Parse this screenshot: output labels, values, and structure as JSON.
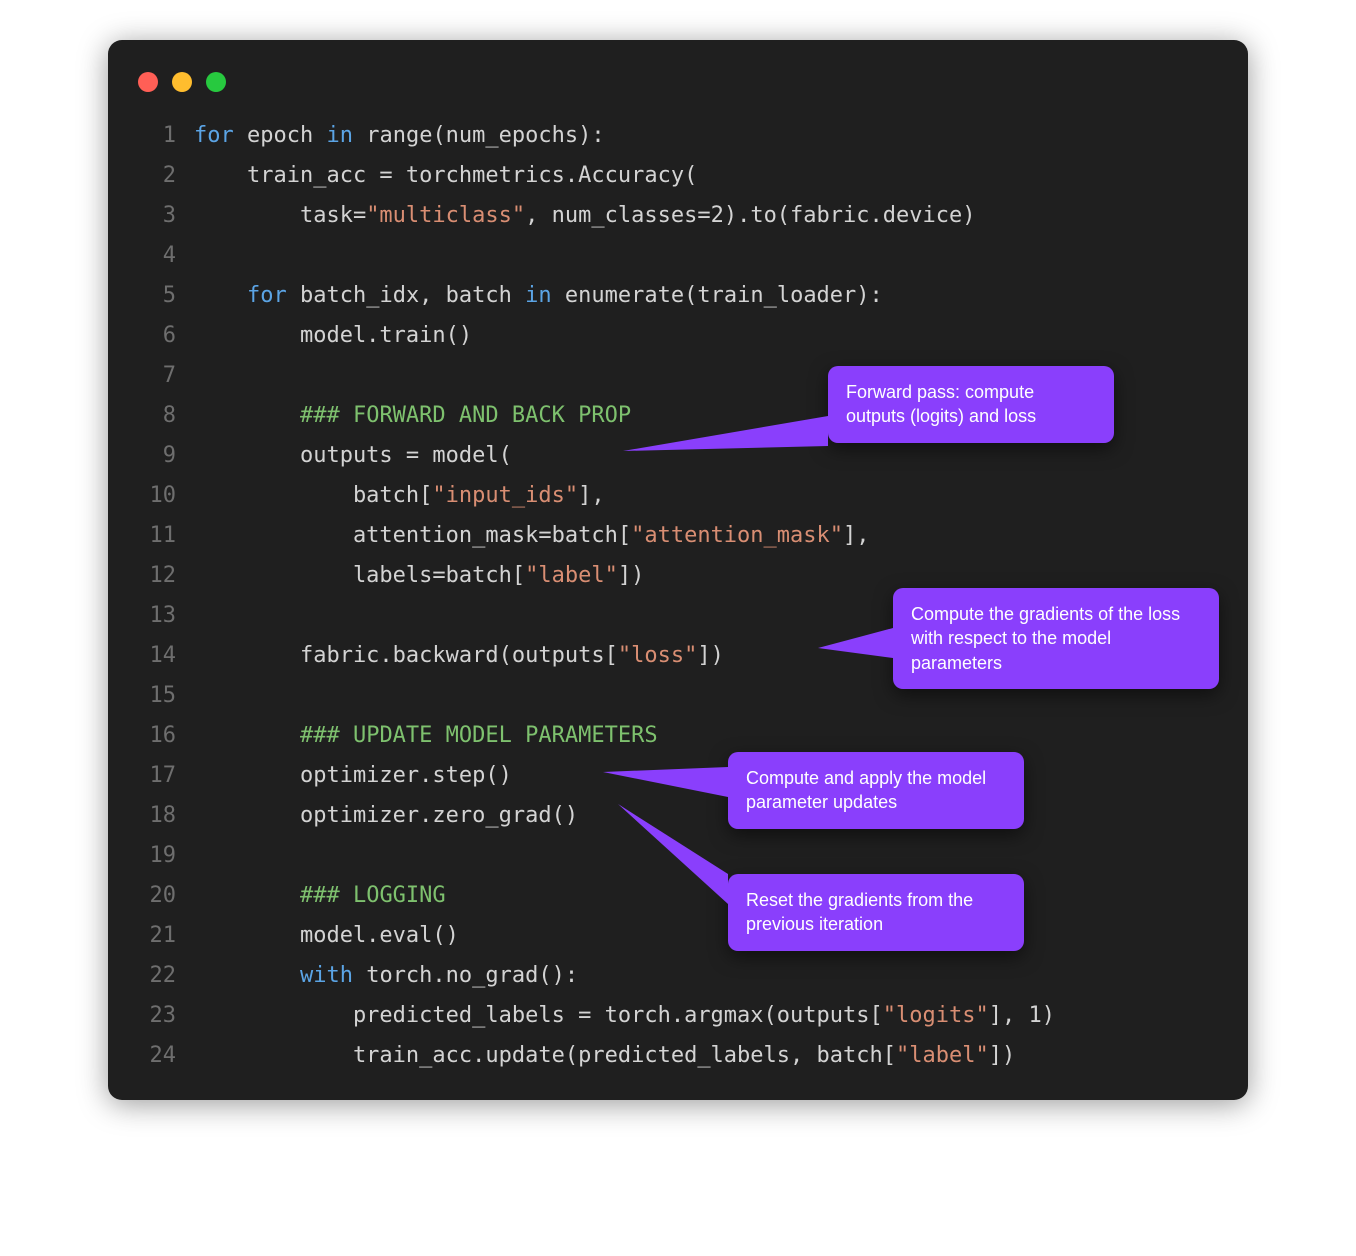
{
  "window": {
    "dots": [
      "red",
      "yellow",
      "green"
    ]
  },
  "code_lines": [
    {
      "n": "1",
      "tokens": [
        [
          "kw",
          "for"
        ],
        [
          "ident",
          " epoch "
        ],
        [
          "kw",
          "in"
        ],
        [
          "ident",
          " range(num_epochs):"
        ]
      ]
    },
    {
      "n": "2",
      "tokens": [
        [
          "ident",
          "    train_acc = torchmetrics.Accuracy("
        ]
      ]
    },
    {
      "n": "3",
      "tokens": [
        [
          "ident",
          "        task="
        ],
        [
          "str",
          "\"multiclass\""
        ],
        [
          "ident",
          ", num_classes="
        ],
        [
          "num",
          "2"
        ],
        [
          "ident",
          ").to(fabric.device)"
        ]
      ]
    },
    {
      "n": "4",
      "tokens": []
    },
    {
      "n": "5",
      "tokens": [
        [
          "ident",
          "    "
        ],
        [
          "kw",
          "for"
        ],
        [
          "ident",
          " batch_idx, batch "
        ],
        [
          "kw",
          "in"
        ],
        [
          "ident",
          " enumerate(train_loader):"
        ]
      ]
    },
    {
      "n": "6",
      "tokens": [
        [
          "ident",
          "        model.train()"
        ]
      ]
    },
    {
      "n": "7",
      "tokens": []
    },
    {
      "n": "8",
      "tokens": [
        [
          "ident",
          "        "
        ],
        [
          "cmt",
          "### FORWARD AND BACK PROP"
        ]
      ]
    },
    {
      "n": "9",
      "tokens": [
        [
          "ident",
          "        outputs = model("
        ]
      ]
    },
    {
      "n": "10",
      "tokens": [
        [
          "ident",
          "            batch["
        ],
        [
          "str",
          "\"input_ids\""
        ],
        [
          "ident",
          "],"
        ]
      ]
    },
    {
      "n": "11",
      "tokens": [
        [
          "ident",
          "            attention_mask=batch["
        ],
        [
          "str",
          "\"attention_mask\""
        ],
        [
          "ident",
          "],"
        ]
      ]
    },
    {
      "n": "12",
      "tokens": [
        [
          "ident",
          "            labels=batch["
        ],
        [
          "str",
          "\"label\""
        ],
        [
          "ident",
          "])"
        ]
      ]
    },
    {
      "n": "13",
      "tokens": []
    },
    {
      "n": "14",
      "tokens": [
        [
          "ident",
          "        fabric.backward(outputs["
        ],
        [
          "str",
          "\"loss\""
        ],
        [
          "ident",
          "])"
        ]
      ]
    },
    {
      "n": "15",
      "tokens": []
    },
    {
      "n": "16",
      "tokens": [
        [
          "ident",
          "        "
        ],
        [
          "cmt",
          "### UPDATE MODEL PARAMETERS"
        ]
      ]
    },
    {
      "n": "17",
      "tokens": [
        [
          "ident",
          "        optimizer.step()"
        ]
      ]
    },
    {
      "n": "18",
      "tokens": [
        [
          "ident",
          "        optimizer.zero_grad()"
        ]
      ]
    },
    {
      "n": "19",
      "tokens": []
    },
    {
      "n": "20",
      "tokens": [
        [
          "ident",
          "        "
        ],
        [
          "cmt",
          "### LOGGING"
        ]
      ]
    },
    {
      "n": "21",
      "tokens": [
        [
          "ident",
          "        model.eval()"
        ]
      ]
    },
    {
      "n": "22",
      "tokens": [
        [
          "ident",
          "        "
        ],
        [
          "kw",
          "with"
        ],
        [
          "ident",
          " torch.no_grad():"
        ]
      ]
    },
    {
      "n": "23",
      "tokens": [
        [
          "ident",
          "            predicted_labels = torch.argmax(outputs["
        ],
        [
          "str",
          "\"logits\""
        ],
        [
          "ident",
          "], "
        ],
        [
          "num",
          "1"
        ],
        [
          "ident",
          ")"
        ]
      ]
    },
    {
      "n": "24",
      "tokens": [
        [
          "ident",
          "            train_acc.update(predicted_labels, batch["
        ],
        [
          "str",
          "\"label\""
        ],
        [
          "ident",
          "])"
        ]
      ]
    }
  ],
  "callouts": {
    "forward": "Forward pass:\ncompute outputs (logits)\nand loss",
    "backward": "Compute the gradients of\nthe loss with respect to the\nmodel parameters",
    "step": "Compute and apply the\nmodel parameter updates",
    "zero": "Reset the gradients from\nthe previous iteration"
  }
}
